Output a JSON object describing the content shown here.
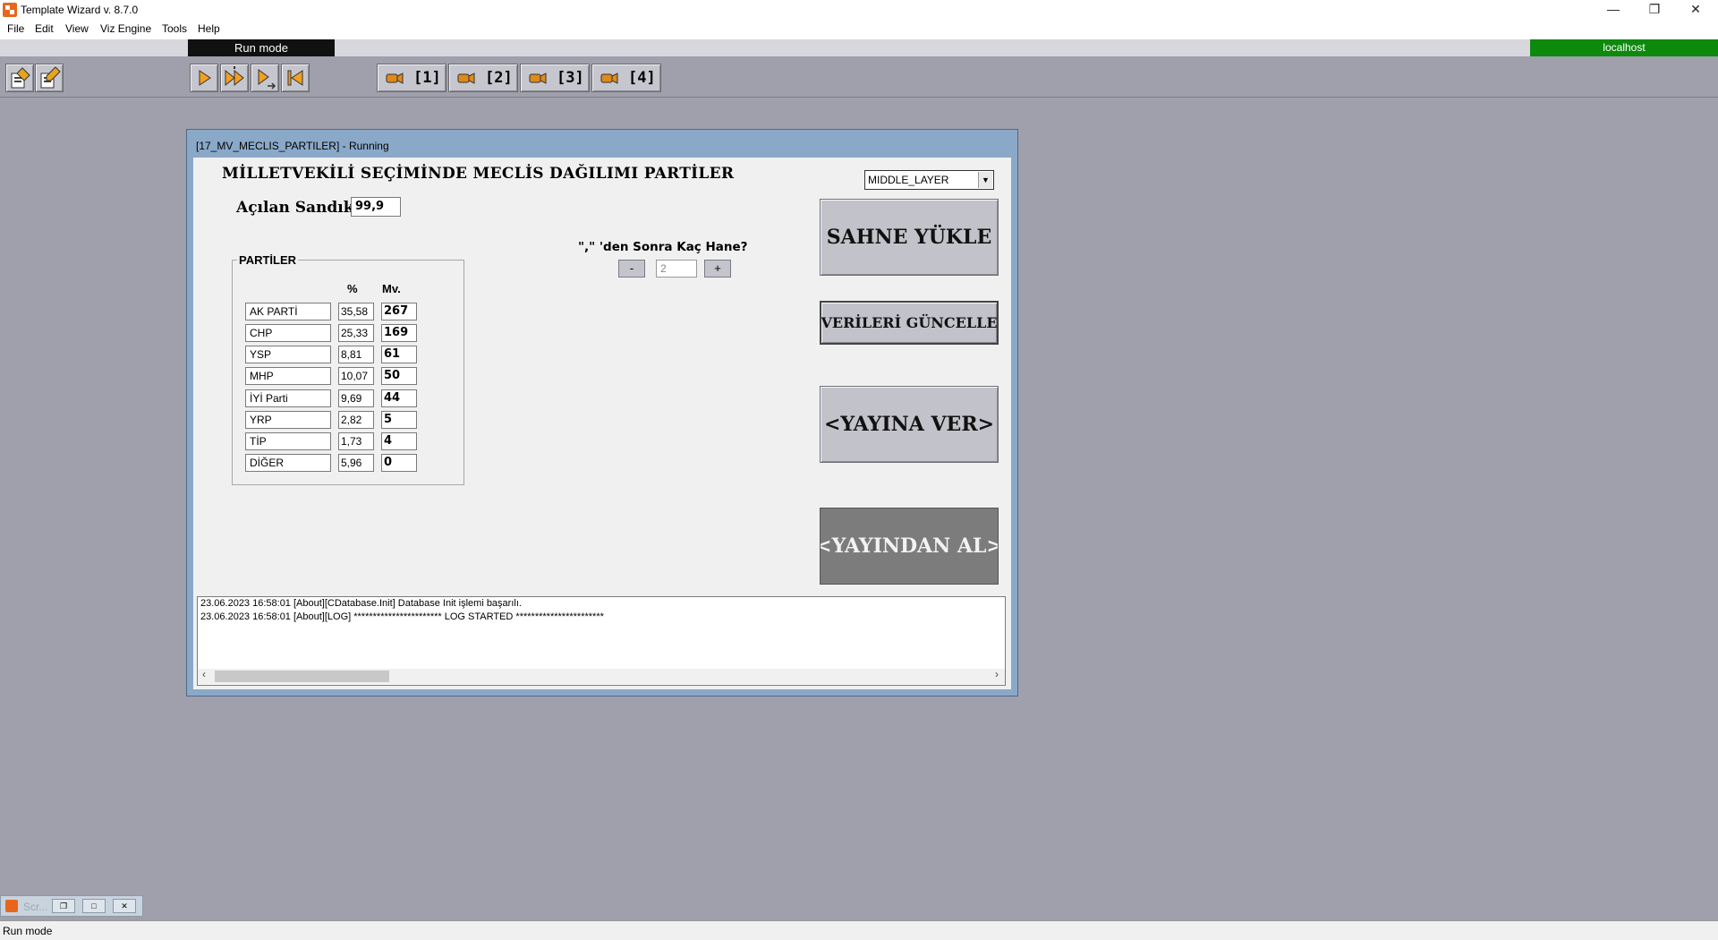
{
  "window": {
    "title": "Template Wizard v. 8.7.0",
    "controls": {
      "minimize": "—",
      "restore": "❐",
      "close": "✕"
    }
  },
  "menu": [
    "File",
    "Edit",
    "View",
    "Viz Engine",
    "Tools",
    "Help"
  ],
  "mode_banner": "Run mode",
  "host": "localhost",
  "host_color": "#0d8a0d",
  "toolbar": {
    "left_icons": [
      "edit-template-icon",
      "edit-data-icon"
    ],
    "playback_icons": [
      "play-icon",
      "continue-icon",
      "play-next-icon",
      "rewind-icon"
    ],
    "camera_buttons": [
      "[1]",
      "[2]",
      "[3]",
      "[4]"
    ]
  },
  "template": {
    "window_title": "[17_MV_MECLIS_PARTILER] - Running",
    "title": "MİLLETVEKİLİ SEÇİMİNDE MECLİS DAĞILIMI PARTİLER",
    "acilan_label": "Açılan Sandık",
    "acilan_value": "99,9",
    "layer": "MIDDLE_LAYER",
    "decimals_label": "\",\" 'den Sonra Kaç Hane?",
    "decimals_minus": "-",
    "decimals_value": "2",
    "decimals_plus": "+",
    "group_label": "PARTİLER",
    "col_pct": "%",
    "col_mv": "Mv.",
    "parties": [
      {
        "name": "AK PARTİ",
        "pct": "35,58",
        "mv": "267"
      },
      {
        "name": "CHP",
        "pct": "25,33",
        "mv": "169"
      },
      {
        "name": "YSP",
        "pct": "8,81",
        "mv": "61"
      },
      {
        "name": "MHP",
        "pct": "10,07",
        "mv": "50"
      },
      {
        "name": "İYİ Parti",
        "pct": "9,69",
        "mv": "44"
      },
      {
        "name": "YRP",
        "pct": "2,82",
        "mv": "5"
      },
      {
        "name": "TİP",
        "pct": "1,73",
        "mv": "4"
      },
      {
        "name": "DİĞER",
        "pct": "5,96",
        "mv": "0"
      }
    ],
    "buttons": {
      "load_scene": "SAHNE YÜKLE",
      "update_data": "VERİLERİ GÜNCELLE",
      "take_on_air": "<YAYINA VER>",
      "take_off_air": "<YAYINDAN AL>"
    },
    "log": [
      "23.06.2023 16:58:01 [About][CDatabase.Init] Database Init işlemi başarılı.",
      "23.06.2023 16:58:01 [About][LOG] *********************** LOG STARTED ***********************"
    ]
  },
  "minimized_window": {
    "title": "Scr..."
  },
  "status": "Run mode"
}
